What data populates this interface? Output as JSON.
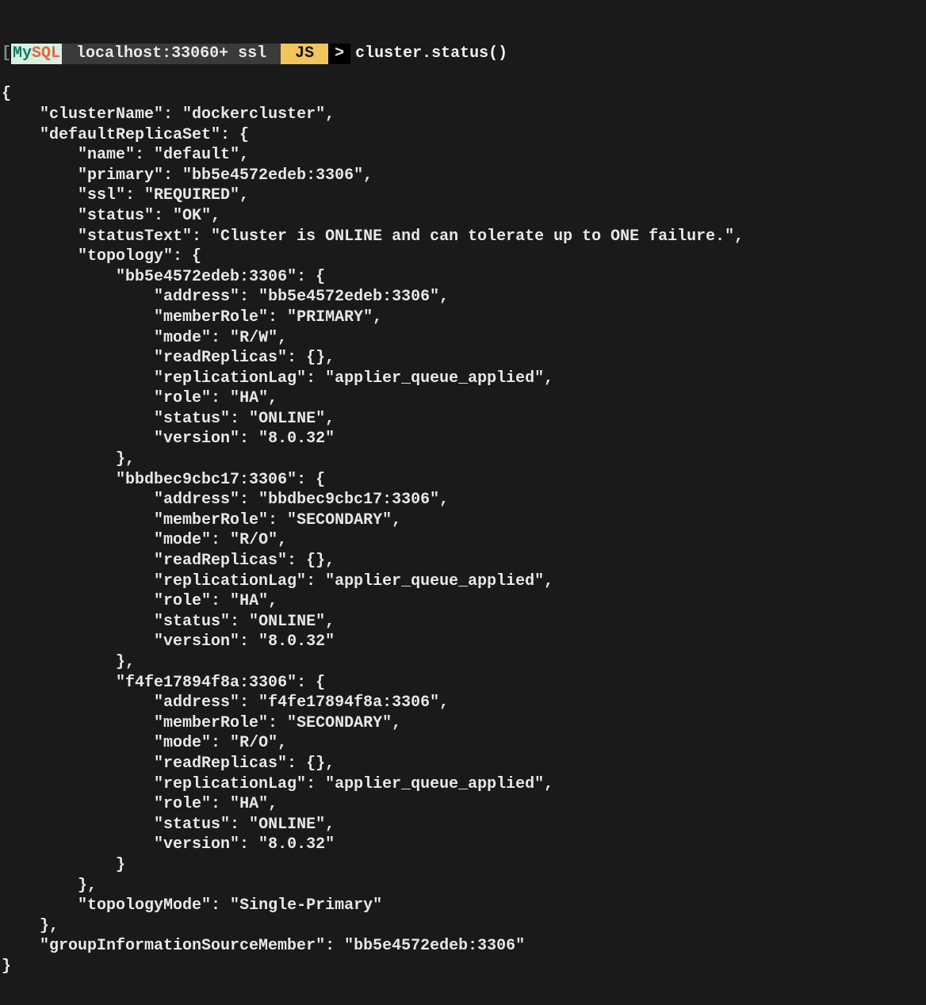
{
  "prompt": {
    "bracket_open": "[",
    "mysql_my": "My",
    "mysql_sql": "SQL",
    "host_segment": " localhost:33060+ ssl ",
    "js_badge": " JS ",
    "arrow": ">",
    "command": "cluster.status()"
  },
  "status": {
    "clusterName": "dockercluster",
    "defaultReplicaSet": {
      "name": "default",
      "primary": "bb5e4572edeb:3306",
      "ssl": "REQUIRED",
      "status": "OK",
      "statusText": "Cluster is ONLINE and can tolerate up to ONE failure.",
      "topology": {
        "bb5e4572edeb:3306": {
          "address": "bb5e4572edeb:3306",
          "memberRole": "PRIMARY",
          "mode": "R/W",
          "readReplicas": "{}",
          "replicationLag": "applier_queue_applied",
          "role": "HA",
          "status": "ONLINE",
          "version": "8.0.32"
        },
        "bbdbec9cbc17:3306": {
          "address": "bbdbec9cbc17:3306",
          "memberRole": "SECONDARY",
          "mode": "R/O",
          "readReplicas": "{}",
          "replicationLag": "applier_queue_applied",
          "role": "HA",
          "status": "ONLINE",
          "version": "8.0.32"
        },
        "f4fe17894f8a:3306": {
          "address": "f4fe17894f8a:3306",
          "memberRole": "SECONDARY",
          "mode": "R/O",
          "readReplicas": "{}",
          "replicationLag": "applier_queue_applied",
          "role": "HA",
          "status": "ONLINE",
          "version": "8.0.32"
        }
      },
      "topologyMode": "Single-Primary"
    },
    "groupInformationSourceMember": "bb5e4572edeb:3306"
  },
  "node_keys": {
    "n1": "bb5e4572edeb:3306",
    "n2": "bbdbec9cbc17:3306",
    "n3": "f4fe17894f8a:3306"
  }
}
